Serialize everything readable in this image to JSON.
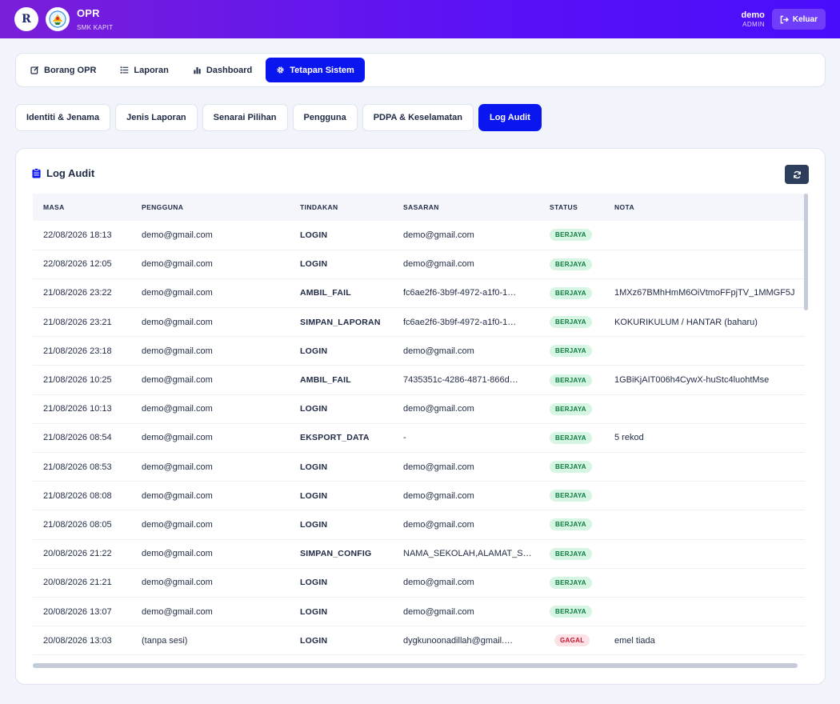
{
  "header": {
    "app_title": "OPR",
    "school_name": "SMK KAPIT",
    "logo_letter": "R",
    "user_name": "demo",
    "user_role": "ADMIN",
    "logout_label": "Keluar"
  },
  "main_nav": [
    {
      "label": "Borang OPR",
      "icon": "edit-icon",
      "active": false
    },
    {
      "label": "Laporan",
      "icon": "list-icon",
      "active": false
    },
    {
      "label": "Dashboard",
      "icon": "bar-chart-icon",
      "active": false
    },
    {
      "label": "Tetapan Sistem",
      "icon": "gear-icon",
      "active": true
    }
  ],
  "sub_tabs": [
    {
      "label": "Identiti & Jenama",
      "active": false
    },
    {
      "label": "Jenis Laporan",
      "active": false
    },
    {
      "label": "Senarai Pilihan",
      "active": false
    },
    {
      "label": "Pengguna",
      "active": false
    },
    {
      "label": "PDPA & Keselamatan",
      "active": false
    },
    {
      "label": "Log Audit",
      "active": true
    }
  ],
  "audit": {
    "title": "Log Audit",
    "columns": [
      "MASA",
      "PENGGUNA",
      "TINDAKAN",
      "SASARAN",
      "STATUS",
      "NOTA"
    ],
    "rows": [
      {
        "masa": "22/08/2026 18:13",
        "pengguna": "demo@gmail.com",
        "tindakan": "LOGIN",
        "sasaran": "demo@gmail.com",
        "status": "BERJAYA",
        "nota": ""
      },
      {
        "masa": "22/08/2026 12:05",
        "pengguna": "demo@gmail.com",
        "tindakan": "LOGIN",
        "sasaran": "demo@gmail.com",
        "status": "BERJAYA",
        "nota": ""
      },
      {
        "masa": "21/08/2026 23:22",
        "pengguna": "demo@gmail.com",
        "tindakan": "AMBIL_FAIL",
        "sasaran": "fc6ae2f6-3b9f-4972-a1f0-1…",
        "status": "BERJAYA",
        "nota": "1MXz67BMhHmM6OiVtmoFFpjTV_1MMGF5J"
      },
      {
        "masa": "21/08/2026 23:21",
        "pengguna": "demo@gmail.com",
        "tindakan": "SIMPAN_LAPORAN",
        "sasaran": "fc6ae2f6-3b9f-4972-a1f0-1…",
        "status": "BERJAYA",
        "nota": "KOKURIKULUM / HANTAR (baharu)"
      },
      {
        "masa": "21/08/2026 23:18",
        "pengguna": "demo@gmail.com",
        "tindakan": "LOGIN",
        "sasaran": "demo@gmail.com",
        "status": "BERJAYA",
        "nota": ""
      },
      {
        "masa": "21/08/2026 10:25",
        "pengguna": "demo@gmail.com",
        "tindakan": "AMBIL_FAIL",
        "sasaran": "7435351c-4286-4871-866d…",
        "status": "BERJAYA",
        "nota": "1GBiKjAIT006h4CywX-huStc4luohtMse"
      },
      {
        "masa": "21/08/2026 10:13",
        "pengguna": "demo@gmail.com",
        "tindakan": "LOGIN",
        "sasaran": "demo@gmail.com",
        "status": "BERJAYA",
        "nota": ""
      },
      {
        "masa": "21/08/2026 08:54",
        "pengguna": "demo@gmail.com",
        "tindakan": "EKSPORT_DATA",
        "sasaran": "-",
        "status": "BERJAYA",
        "nota": "5 rekod"
      },
      {
        "masa": "21/08/2026 08:53",
        "pengguna": "demo@gmail.com",
        "tindakan": "LOGIN",
        "sasaran": "demo@gmail.com",
        "status": "BERJAYA",
        "nota": ""
      },
      {
        "masa": "21/08/2026 08:08",
        "pengguna": "demo@gmail.com",
        "tindakan": "LOGIN",
        "sasaran": "demo@gmail.com",
        "status": "BERJAYA",
        "nota": ""
      },
      {
        "masa": "21/08/2026 08:05",
        "pengguna": "demo@gmail.com",
        "tindakan": "LOGIN",
        "sasaran": "demo@gmail.com",
        "status": "BERJAYA",
        "nota": ""
      },
      {
        "masa": "20/08/2026 21:22",
        "pengguna": "demo@gmail.com",
        "tindakan": "SIMPAN_CONFIG",
        "sasaran": "NAMA_SEKOLAH,ALAMAT_S…",
        "status": "BERJAYA",
        "nota": ""
      },
      {
        "masa": "20/08/2026 21:21",
        "pengguna": "demo@gmail.com",
        "tindakan": "LOGIN",
        "sasaran": "demo@gmail.com",
        "status": "BERJAYA",
        "nota": ""
      },
      {
        "masa": "20/08/2026 13:07",
        "pengguna": "demo@gmail.com",
        "tindakan": "LOGIN",
        "sasaran": "demo@gmail.com",
        "status": "BERJAYA",
        "nota": ""
      },
      {
        "masa": "20/08/2026 13:03",
        "pengguna": "(tanpa sesi)",
        "tindakan": "LOGIN",
        "sasaran": "dygkunoonadillah@gmail.…",
        "status": "GAGAL",
        "nota": "emel tiada"
      }
    ]
  },
  "colors": {
    "accent": "#0a16f0",
    "header_start": "#7a1fd9",
    "header_end": "#4a0dfb",
    "success": "#0b7a3e",
    "danger": "#c8102e"
  }
}
